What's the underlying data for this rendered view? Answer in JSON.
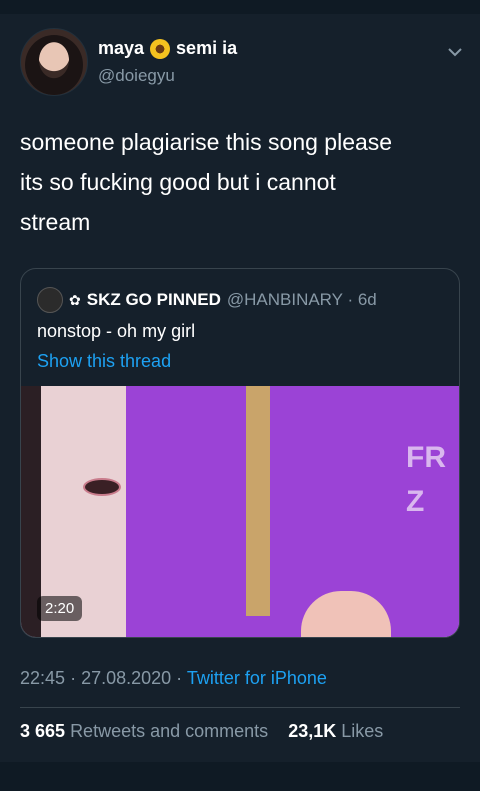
{
  "tweet": {
    "display_name": "maya",
    "display_name_suffix": "semi ia",
    "handle": "@doiegyu",
    "text_lines": [
      "someone plagiarise this song please",
      "its so fucking good but i cannot",
      "stream"
    ],
    "time": "22:45",
    "date": "27.08.2020",
    "source": "Twitter for iPhone",
    "retweets_count": "3 665",
    "retweets_label": "Retweets and comments",
    "likes_count": "23,1K",
    "likes_label": "Likes"
  },
  "quoted": {
    "name": "SKZ GO PINNED",
    "handle": "@HANBINARY",
    "age": "6d",
    "text": "nonstop - oh my girl",
    "link": "Show this thread",
    "video_duration": "2:20",
    "book_text_1": "FR",
    "book_text_2": "Z"
  },
  "icons": {
    "chevron": "chevron-down-icon",
    "emoji": "sunflower",
    "flower": "✿"
  },
  "colors": {
    "background": "#15202b",
    "accent": "#1da1f2",
    "secondary_text": "#8899a6"
  }
}
